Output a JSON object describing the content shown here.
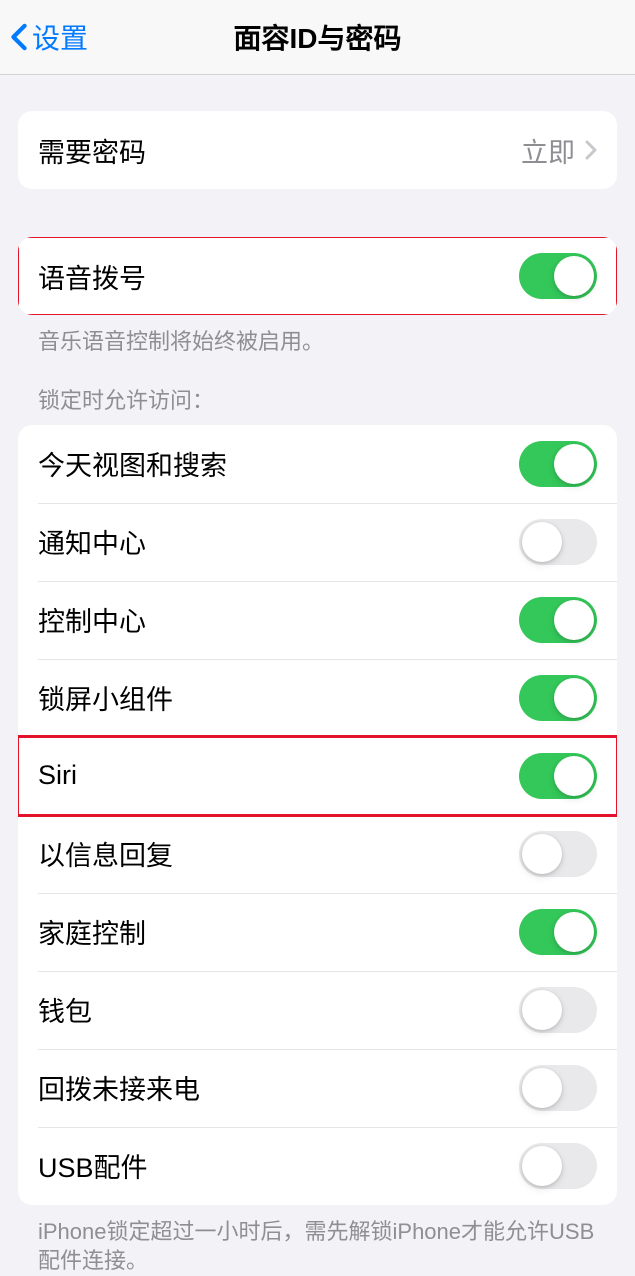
{
  "nav": {
    "back_label": "设置",
    "title": "面容ID与密码"
  },
  "require_passcode": {
    "label": "需要密码",
    "value": "立即"
  },
  "voice_dial": {
    "label": "语音拨号",
    "enabled": true,
    "footer": "音乐语音控制将始终被启用。"
  },
  "lock_access": {
    "header": "锁定时允许访问：",
    "items": [
      {
        "label": "今天视图和搜索",
        "enabled": true
      },
      {
        "label": "通知中心",
        "enabled": false
      },
      {
        "label": "控制中心",
        "enabled": true
      },
      {
        "label": "锁屏小组件",
        "enabled": true
      },
      {
        "label": "Siri",
        "enabled": true
      },
      {
        "label": "以信息回复",
        "enabled": false
      },
      {
        "label": "家庭控制",
        "enabled": true
      },
      {
        "label": "钱包",
        "enabled": false
      },
      {
        "label": "回拨未接来电",
        "enabled": false
      },
      {
        "label": "USB配件",
        "enabled": false
      }
    ],
    "footer": "iPhone锁定超过一小时后，需先解锁iPhone才能允许USB配件连接。"
  },
  "highlighted_rows": [
    "语音拨号",
    "Siri"
  ]
}
